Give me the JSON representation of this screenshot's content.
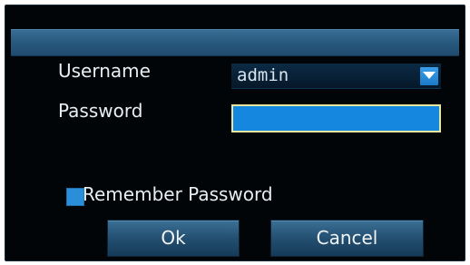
{
  "login": {
    "username_label": "Username",
    "username_value": "admin",
    "password_label": "Password",
    "password_value": "",
    "remember_label": "Remember Password",
    "remember_checked": true,
    "ok_label": "Ok",
    "cancel_label": "Cancel"
  },
  "colors": {
    "titlebar": "#2a5a80",
    "input_focus": "#1687df",
    "focus_border": "#e6e6a0",
    "dialog_bg": "#020507"
  }
}
